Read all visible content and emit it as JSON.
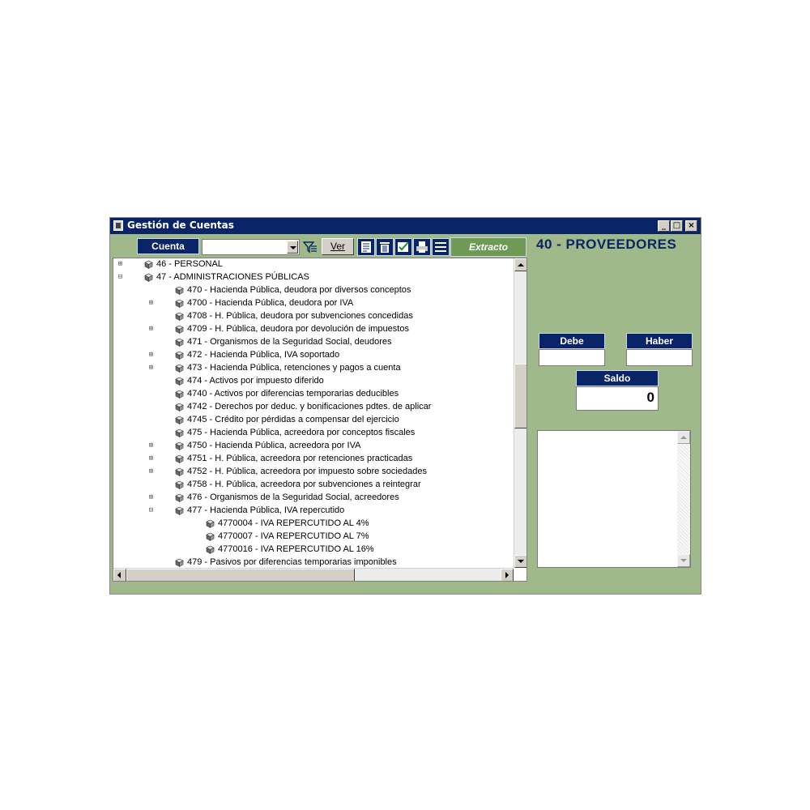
{
  "window": {
    "title": "Gestión de Cuentas",
    "controls": {
      "minimize": "_",
      "maximize": "□",
      "close": "×"
    }
  },
  "toolbar": {
    "cuenta_label": "Cuenta",
    "cuenta_value": "",
    "ver_label": "Ver",
    "extracto_label": "Extracto"
  },
  "account_title": "40 - PROVEEDORES",
  "tree": {
    "rows": [
      {
        "indent": 0,
        "expander": "⊞",
        "label": "46 - PERSONAL"
      },
      {
        "indent": 0,
        "expander": "⊟",
        "label": "47 - ADMINISTRACIONES PÚBLICAS"
      },
      {
        "indent": 1,
        "expander": "",
        "label": "470 - Hacienda Pública, deudora por diversos conceptos"
      },
      {
        "indent": 1,
        "expander": "⊞",
        "label": "4700 - Hacienda Pública, deudora por IVA"
      },
      {
        "indent": 1,
        "expander": "",
        "label": "4708 - H. Pública, deudora por subvenciones concedidas"
      },
      {
        "indent": 1,
        "expander": "⊞",
        "label": "4709 - H. Pública, deudora por devolución de impuestos"
      },
      {
        "indent": 1,
        "expander": "",
        "label": "471 - Organismos de la Seguridad Social, deudores"
      },
      {
        "indent": 1,
        "expander": "⊞",
        "label": "472 - Hacienda Pública, IVA soportado"
      },
      {
        "indent": 1,
        "expander": "⊞",
        "label": "473 - Hacienda Pública, retenciones y pagos a cuenta"
      },
      {
        "indent": 1,
        "expander": "",
        "label": "474 - Activos por impuesto diferido"
      },
      {
        "indent": 1,
        "expander": "",
        "label": "4740 - Activos por diferencias temporarias deducibles"
      },
      {
        "indent": 1,
        "expander": "",
        "label": "4742 - Derechos por deduc. y bonificaciones pdtes. de aplicar"
      },
      {
        "indent": 1,
        "expander": "",
        "label": "4745 - Crédito por pérdidas a compensar del ejercicio"
      },
      {
        "indent": 1,
        "expander": "",
        "label": "475 - Hacienda Pública, acreedora por conceptos fiscales"
      },
      {
        "indent": 1,
        "expander": "⊞",
        "label": "4750 - Hacienda Pública, acreedora por IVA"
      },
      {
        "indent": 1,
        "expander": "⊞",
        "label": "4751 - H. Pública, acreedora por retenciones practicadas"
      },
      {
        "indent": 1,
        "expander": "⊞",
        "label": "4752 - H. Pública, acreedora por impuesto sobre sociedades"
      },
      {
        "indent": 1,
        "expander": "",
        "label": "4758 - H. Pública, acreedora por subvenciones a reintegrar"
      },
      {
        "indent": 1,
        "expander": "⊞",
        "label": "476 - Organismos de la Seguridad Social, acreedores"
      },
      {
        "indent": 1,
        "expander": "⊟",
        "label": "477 - Hacienda Pública, IVA repercutido"
      },
      {
        "indent": 2,
        "expander": "",
        "label": "4770004 - IVA REPERCUTIDO AL 4%"
      },
      {
        "indent": 2,
        "expander": "",
        "label": "4770007 - IVA REPERCUTIDO AL 7%"
      },
      {
        "indent": 2,
        "expander": "",
        "label": "4770016 - IVA REPERCUTIDO AL 16%"
      },
      {
        "indent": 1,
        "expander": "",
        "label": "479 - Pasivos por diferencias temporarias imponibles"
      }
    ]
  },
  "totals": {
    "debe_label": "Debe",
    "debe_value": "",
    "haber_label": "Haber",
    "haber_value": "",
    "saldo_label": "Saldo",
    "saldo_value": "0"
  },
  "colors": {
    "window_bg": "#9fb98b",
    "title_bar": "#0a2468",
    "extracto_bg": "#6e9a55",
    "accent_text": "#0a2468"
  }
}
